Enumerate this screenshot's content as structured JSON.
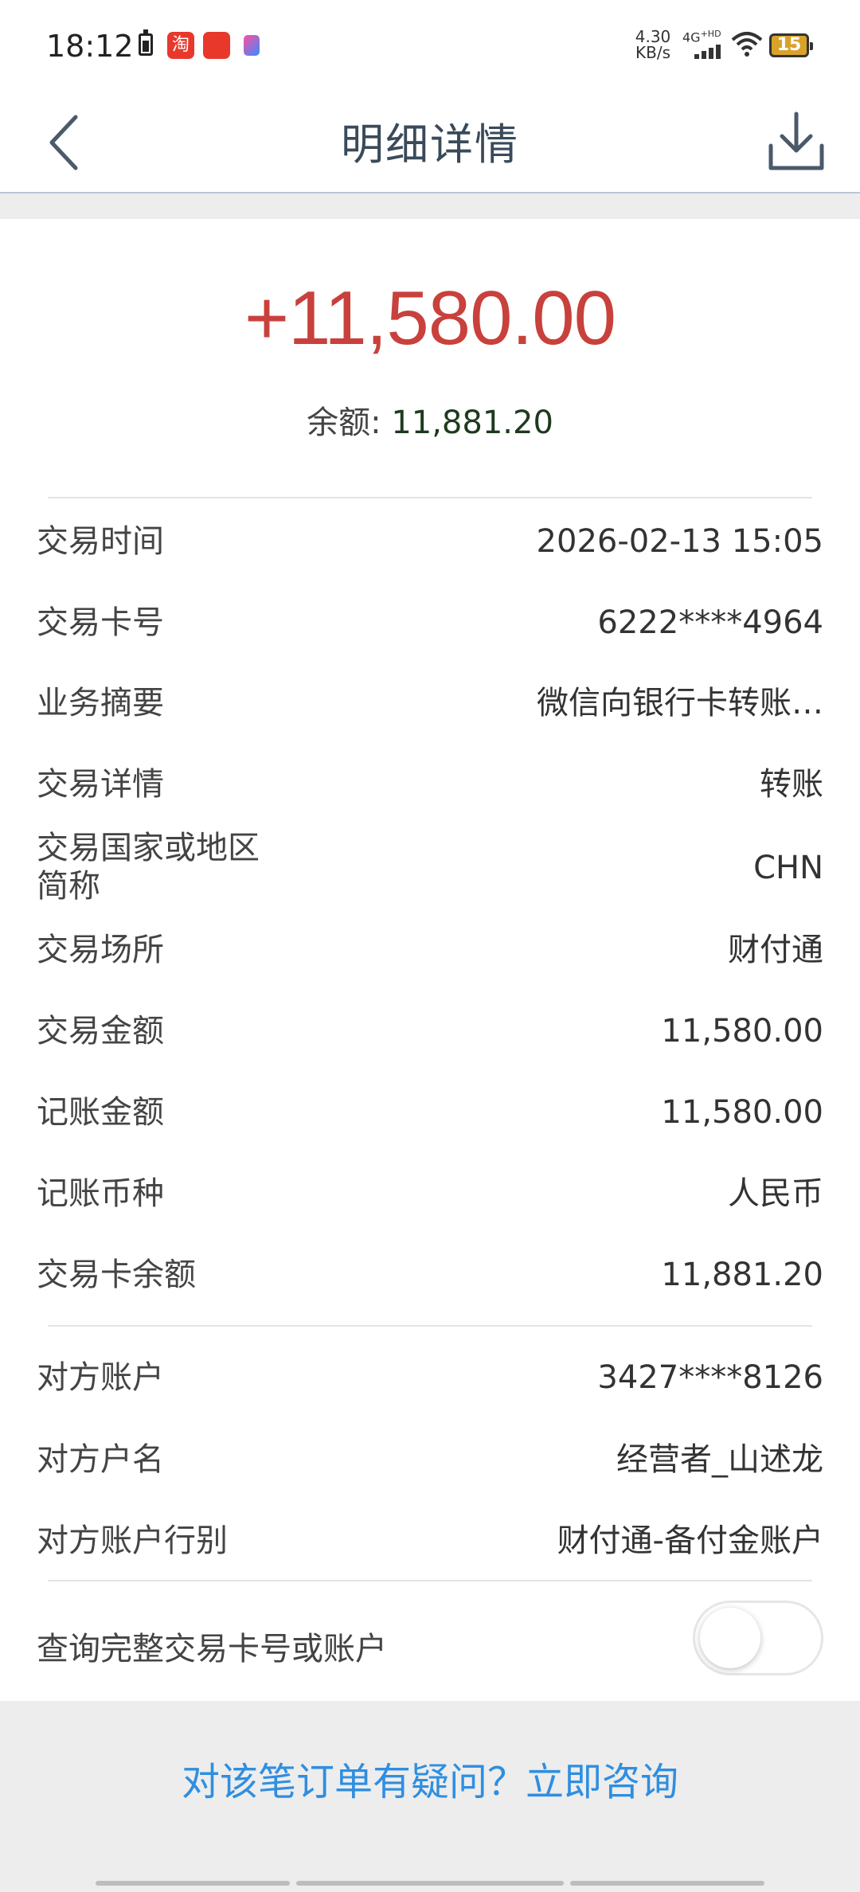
{
  "status_bar": {
    "time": "18:12",
    "net_speed": "4.30\nKB/s",
    "net_speed_value": "4.30",
    "net_speed_unit": "KB/s",
    "signal_label": "4G HD",
    "battery": "15"
  },
  "header": {
    "title": "明细详情"
  },
  "summary": {
    "amount": "+11,580.00",
    "balance_label": "余额: ",
    "balance_value": "11,881.20"
  },
  "details": [
    {
      "label": "交易时间",
      "value": "2026-02-13 15:05"
    },
    {
      "label": "交易卡号",
      "value": "6222****4964"
    },
    {
      "label": "业务摘要",
      "value": "微信向银行卡转账…"
    },
    {
      "label": "交易详情",
      "value": "转账"
    },
    {
      "label": "交易国家或地区简称",
      "label_line1": "交易国家或地区",
      "label_line2": "简称",
      "value": "CHN"
    },
    {
      "label": "交易场所",
      "value": "财付通"
    },
    {
      "label": "交易金额",
      "value": "11,580.00"
    },
    {
      "label": "记账金额",
      "value": "11,580.00"
    },
    {
      "label": "记账币种",
      "value": "人民币"
    },
    {
      "label": "交易卡余额",
      "value": "11,881.20"
    }
  ],
  "counterparty": [
    {
      "label": "对方账户",
      "value": "3427****8126"
    },
    {
      "label": "对方户名",
      "value": "经营者_山述龙"
    },
    {
      "label": "对方账户行别",
      "value": "财付通-备付金账户"
    }
  ],
  "toggle": {
    "label": "查询完整交易卡号或账户",
    "on": false
  },
  "footer": {
    "consult_text": "对该笔订单有疑问？立即咨询"
  },
  "colors": {
    "amount": "#c8413c",
    "link": "#2f8ee0",
    "title": "#3a4a5a"
  }
}
